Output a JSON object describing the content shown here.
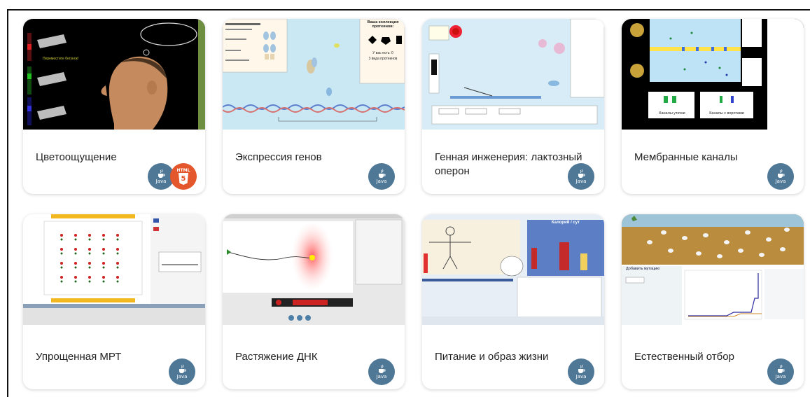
{
  "cards": [
    {
      "title": "Цветоощущение",
      "badges": [
        "java",
        "html5"
      ],
      "thumb_speech": "Переместите бегунок!"
    },
    {
      "title": "Экспрессия генов",
      "badges": [
        "java"
      ],
      "thumb_heading": "Ваша коллекция протеинов:",
      "thumb_sub": "У вас есть: 0",
      "thumb_sub2": "3 вида протеинов"
    },
    {
      "title": "Генная инженерия: лактозный оперон",
      "badges": [
        "java"
      ]
    },
    {
      "title": "Мембранные каналы",
      "badges": [
        "java"
      ],
      "thumb_btn1": "Каналы утечки",
      "thumb_btn2": "Каналы с воротами"
    },
    {
      "title": "Упрощенная МРТ",
      "badges": [
        "java"
      ]
    },
    {
      "title": "Растяжение ДНК",
      "badges": [
        "java"
      ]
    },
    {
      "title": "Питание и образ жизни",
      "badges": [
        "java"
      ],
      "thumb_heading": "Калорий / сут"
    },
    {
      "title": "Естественный отбор",
      "badges": [
        "java"
      ],
      "thumb_btn": "Добавить мутацию"
    }
  ],
  "badge_labels": {
    "java": "Java",
    "html5_word": "HTML",
    "html5_num": "5"
  },
  "colors": {
    "java_badge": "#4f7897",
    "html5_badge": "#e4562b",
    "card_title": "#222222"
  }
}
